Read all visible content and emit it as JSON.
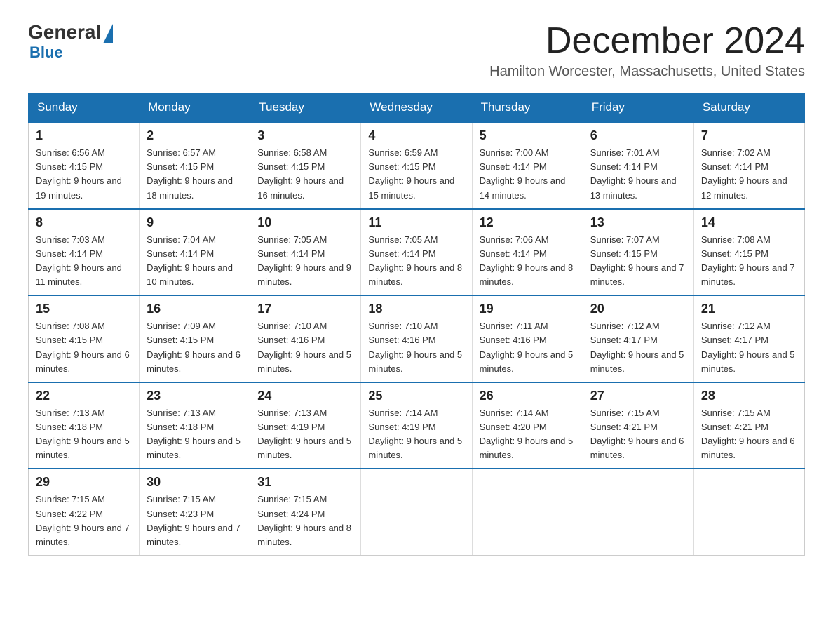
{
  "header": {
    "logo_general": "General",
    "logo_blue": "Blue",
    "month_title": "December 2024",
    "location": "Hamilton Worcester, Massachusetts, United States"
  },
  "days_of_week": [
    "Sunday",
    "Monday",
    "Tuesday",
    "Wednesday",
    "Thursday",
    "Friday",
    "Saturday"
  ],
  "weeks": [
    [
      {
        "day": "1",
        "sunrise": "6:56 AM",
        "sunset": "4:15 PM",
        "daylight": "9 hours and 19 minutes."
      },
      {
        "day": "2",
        "sunrise": "6:57 AM",
        "sunset": "4:15 PM",
        "daylight": "9 hours and 18 minutes."
      },
      {
        "day": "3",
        "sunrise": "6:58 AM",
        "sunset": "4:15 PM",
        "daylight": "9 hours and 16 minutes."
      },
      {
        "day": "4",
        "sunrise": "6:59 AM",
        "sunset": "4:15 PM",
        "daylight": "9 hours and 15 minutes."
      },
      {
        "day": "5",
        "sunrise": "7:00 AM",
        "sunset": "4:14 PM",
        "daylight": "9 hours and 14 minutes."
      },
      {
        "day": "6",
        "sunrise": "7:01 AM",
        "sunset": "4:14 PM",
        "daylight": "9 hours and 13 minutes."
      },
      {
        "day": "7",
        "sunrise": "7:02 AM",
        "sunset": "4:14 PM",
        "daylight": "9 hours and 12 minutes."
      }
    ],
    [
      {
        "day": "8",
        "sunrise": "7:03 AM",
        "sunset": "4:14 PM",
        "daylight": "9 hours and 11 minutes."
      },
      {
        "day": "9",
        "sunrise": "7:04 AM",
        "sunset": "4:14 PM",
        "daylight": "9 hours and 10 minutes."
      },
      {
        "day": "10",
        "sunrise": "7:05 AM",
        "sunset": "4:14 PM",
        "daylight": "9 hours and 9 minutes."
      },
      {
        "day": "11",
        "sunrise": "7:05 AM",
        "sunset": "4:14 PM",
        "daylight": "9 hours and 8 minutes."
      },
      {
        "day": "12",
        "sunrise": "7:06 AM",
        "sunset": "4:14 PM",
        "daylight": "9 hours and 8 minutes."
      },
      {
        "day": "13",
        "sunrise": "7:07 AM",
        "sunset": "4:15 PM",
        "daylight": "9 hours and 7 minutes."
      },
      {
        "day": "14",
        "sunrise": "7:08 AM",
        "sunset": "4:15 PM",
        "daylight": "9 hours and 7 minutes."
      }
    ],
    [
      {
        "day": "15",
        "sunrise": "7:08 AM",
        "sunset": "4:15 PM",
        "daylight": "9 hours and 6 minutes."
      },
      {
        "day": "16",
        "sunrise": "7:09 AM",
        "sunset": "4:15 PM",
        "daylight": "9 hours and 6 minutes."
      },
      {
        "day": "17",
        "sunrise": "7:10 AM",
        "sunset": "4:16 PM",
        "daylight": "9 hours and 5 minutes."
      },
      {
        "day": "18",
        "sunrise": "7:10 AM",
        "sunset": "4:16 PM",
        "daylight": "9 hours and 5 minutes."
      },
      {
        "day": "19",
        "sunrise": "7:11 AM",
        "sunset": "4:16 PM",
        "daylight": "9 hours and 5 minutes."
      },
      {
        "day": "20",
        "sunrise": "7:12 AM",
        "sunset": "4:17 PM",
        "daylight": "9 hours and 5 minutes."
      },
      {
        "day": "21",
        "sunrise": "7:12 AM",
        "sunset": "4:17 PM",
        "daylight": "9 hours and 5 minutes."
      }
    ],
    [
      {
        "day": "22",
        "sunrise": "7:13 AM",
        "sunset": "4:18 PM",
        "daylight": "9 hours and 5 minutes."
      },
      {
        "day": "23",
        "sunrise": "7:13 AM",
        "sunset": "4:18 PM",
        "daylight": "9 hours and 5 minutes."
      },
      {
        "day": "24",
        "sunrise": "7:13 AM",
        "sunset": "4:19 PM",
        "daylight": "9 hours and 5 minutes."
      },
      {
        "day": "25",
        "sunrise": "7:14 AM",
        "sunset": "4:19 PM",
        "daylight": "9 hours and 5 minutes."
      },
      {
        "day": "26",
        "sunrise": "7:14 AM",
        "sunset": "4:20 PM",
        "daylight": "9 hours and 5 minutes."
      },
      {
        "day": "27",
        "sunrise": "7:15 AM",
        "sunset": "4:21 PM",
        "daylight": "9 hours and 6 minutes."
      },
      {
        "day": "28",
        "sunrise": "7:15 AM",
        "sunset": "4:21 PM",
        "daylight": "9 hours and 6 minutes."
      }
    ],
    [
      {
        "day": "29",
        "sunrise": "7:15 AM",
        "sunset": "4:22 PM",
        "daylight": "9 hours and 7 minutes."
      },
      {
        "day": "30",
        "sunrise": "7:15 AM",
        "sunset": "4:23 PM",
        "daylight": "9 hours and 7 minutes."
      },
      {
        "day": "31",
        "sunrise": "7:15 AM",
        "sunset": "4:24 PM",
        "daylight": "9 hours and 8 minutes."
      },
      null,
      null,
      null,
      null
    ]
  ],
  "labels": {
    "sunrise": "Sunrise: ",
    "sunset": "Sunset: ",
    "daylight": "Daylight: "
  }
}
